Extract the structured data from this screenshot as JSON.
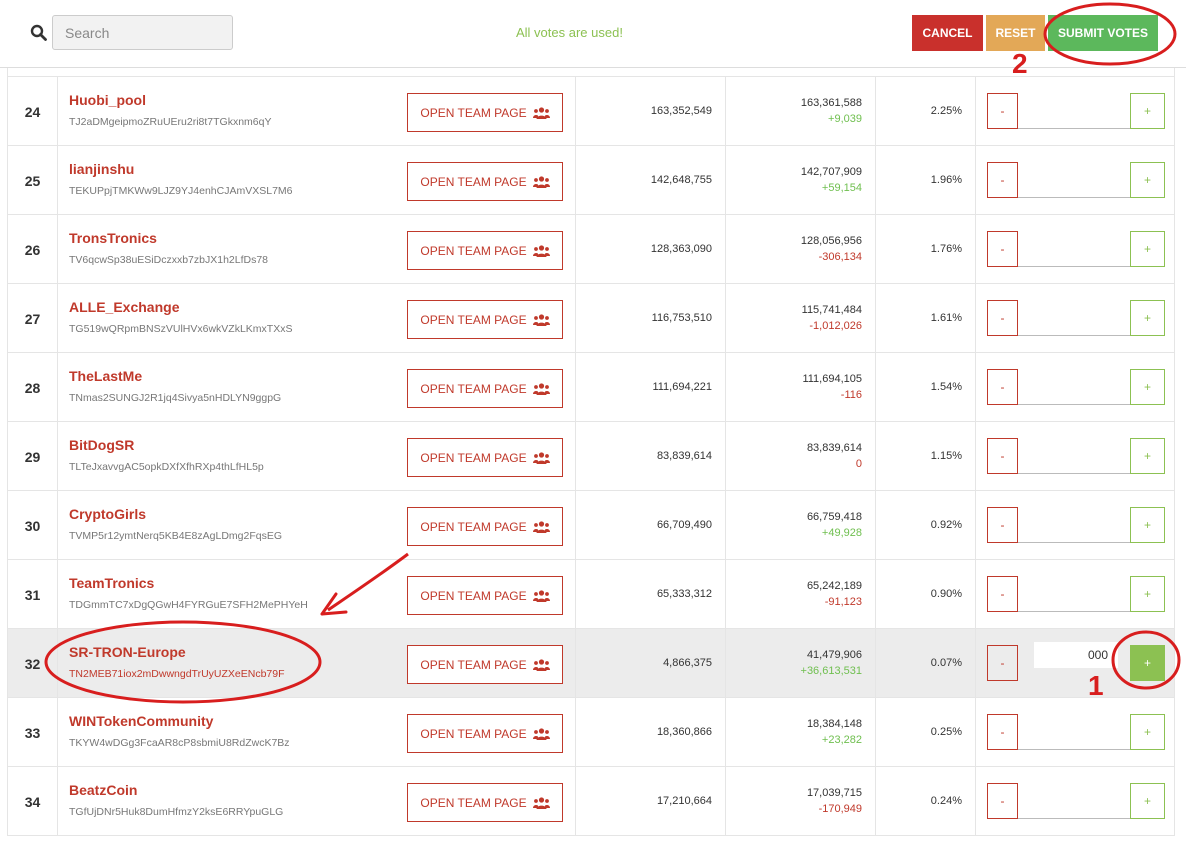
{
  "toolbar": {
    "search_placeholder": "Search",
    "votes_message": "All votes are used!",
    "cancel_label": "CANCEL",
    "reset_label": "RESET",
    "submit_label": "SUBMIT VOTES"
  },
  "team_button_label": "OPEN TEAM PAGE",
  "rows": [
    {
      "rank": "24",
      "name": "Huobi_pool",
      "address": "TJ2aDMgeipmoZRuUEru2ri8t7TGkxnm6qY",
      "votes": "163,352,549",
      "current": "163,361,588",
      "delta": "+9,039",
      "delta_sign": "pos",
      "percent": "2.25%",
      "vote_value": ""
    },
    {
      "rank": "25",
      "name": "lianjinshu",
      "address": "TEKUPpjTMKWw9LJZ9YJ4enhCJAmVXSL7M6",
      "votes": "142,648,755",
      "current": "142,707,909",
      "delta": "+59,154",
      "delta_sign": "pos",
      "percent": "1.96%",
      "vote_value": ""
    },
    {
      "rank": "26",
      "name": "TronsTronics",
      "address": "TV6qcwSp38uESiDczxxb7zbJX1h2LfDs78",
      "votes": "128,363,090",
      "current": "128,056,956",
      "delta": "-306,134",
      "delta_sign": "neg",
      "percent": "1.76%",
      "vote_value": ""
    },
    {
      "rank": "27",
      "name": "ALLE_Exchange",
      "address": "TG519wQRpmBNSzVUlHVx6wkVZkLKmxTXxS",
      "votes": "116,753,510",
      "current": "115,741,484",
      "delta": "-1,012,026",
      "delta_sign": "neg",
      "percent": "1.61%",
      "vote_value": ""
    },
    {
      "rank": "28",
      "name": "TheLastMe",
      "address": "TNmas2SUNGJ2R1jq4Sivya5nHDLYN9ggpG",
      "votes": "111,694,221",
      "current": "111,694,105",
      "delta": "-116",
      "delta_sign": "neg",
      "percent": "1.54%",
      "vote_value": ""
    },
    {
      "rank": "29",
      "name": "BitDogSR",
      "address": "TLTeJxavvgAC5opkDXfXfhRXp4thLfHL5p",
      "votes": "83,839,614",
      "current": "83,839,614",
      "delta": "0",
      "delta_sign": "neg",
      "percent": "1.15%",
      "vote_value": ""
    },
    {
      "rank": "30",
      "name": "CryptoGirls",
      "address": "TVMP5r12ymtNerq5KB4E8zAgLDmg2FqsEG",
      "votes": "66,709,490",
      "current": "66,759,418",
      "delta": "+49,928",
      "delta_sign": "pos",
      "percent": "0.92%",
      "vote_value": ""
    },
    {
      "rank": "31",
      "name": "TeamTronics",
      "address": "TDGmmTC7xDgQGwH4FYRGuE7SFH2MePHYeH",
      "votes": "65,333,312",
      "current": "65,242,189",
      "delta": "-91,123",
      "delta_sign": "neg",
      "percent": "0.90%",
      "vote_value": ""
    },
    {
      "rank": "32",
      "name": "SR-TRON-Europe",
      "address": "TN2MEB71iox2mDwwngdTrUyUZXeENcb79F",
      "votes": "4,866,375",
      "current": "41,479,906",
      "delta": "+36,613,531",
      "delta_sign": "pos",
      "percent": "0.07%",
      "vote_value": "000"
    },
    {
      "rank": "33",
      "name": "WINTokenCommunity",
      "address": "TKYW4wDGg3FcaAR8cP8sbmiU8RdZwcK7Bz",
      "votes": "18,360,866",
      "current": "18,384,148",
      "delta": "+23,282",
      "delta_sign": "pos",
      "percent": "0.25%",
      "vote_value": ""
    },
    {
      "rank": "34",
      "name": "BeatzCoin",
      "address": "TGfUjDNr5Huk8DumHfmzY2ksE6RRYpuGLG",
      "votes": "17,210,664",
      "current": "17,039,715",
      "delta": "-170,949",
      "delta_sign": "neg",
      "percent": "0.24%",
      "vote_value": ""
    }
  ],
  "vote_controls": {
    "minus": "-",
    "plus": "+"
  },
  "annotations": {
    "step_one": "1",
    "step_two": "2"
  },
  "colors": {
    "accent_red": "#c0392b",
    "accent_green": "#8cc152",
    "cancel": "#c9302c",
    "reset": "#e3a857",
    "submit": "#5cb85c",
    "annotation": "#d81e1e"
  }
}
